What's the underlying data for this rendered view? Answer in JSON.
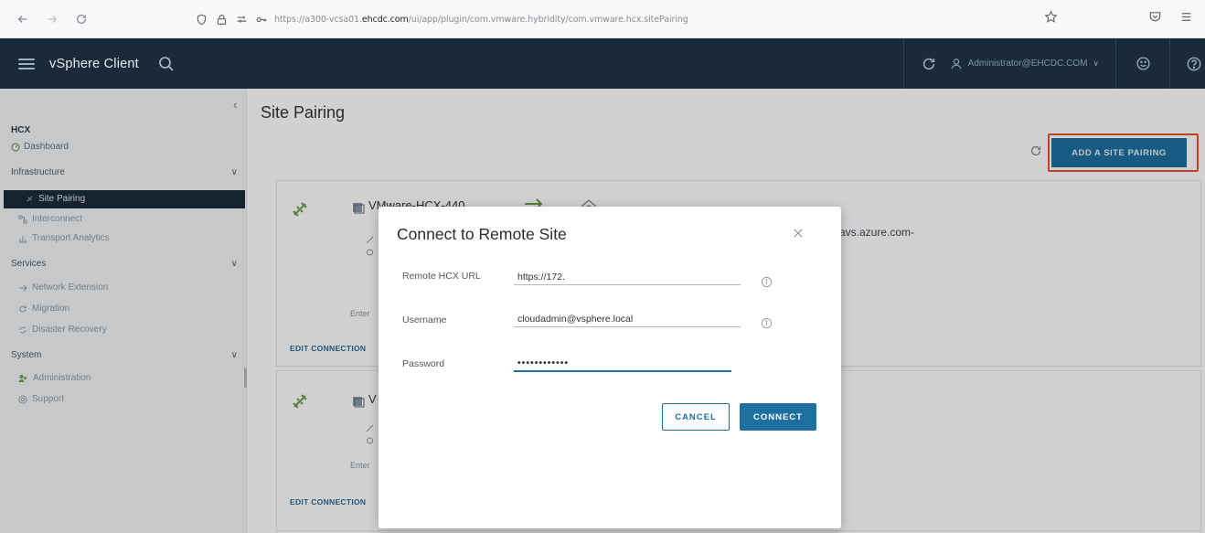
{
  "browser": {
    "url_prefix": "https://a300-vcsa01.",
    "url_domain": "ehcdc.com",
    "url_suffix": "/ui/app/plugin/com.vmware.hybridity/com.vmware.hcx.sitePairing"
  },
  "header": {
    "app_title": "vSphere Client",
    "user": "Administrator@EHCDC.COM"
  },
  "sidebar": {
    "hcx_label": "HCX",
    "dashboard": "Dashboard",
    "sections": [
      {
        "label": "Infrastructure",
        "items": [
          "Site Pairing",
          "Interconnect",
          "Transport Analytics"
        ]
      },
      {
        "label": "Services",
        "items": [
          "Network Extension",
          "Migration",
          "Disaster Recovery"
        ]
      },
      {
        "label": "System",
        "items": [
          "Administration",
          "Support"
        ]
      }
    ],
    "active_item": "Site Pairing"
  },
  "main": {
    "page_title": "Site Pairing",
    "add_button": "ADD A SITE PAIRING",
    "cards": [
      {
        "title": "VMware-HCX-440",
        "remote": "avs.azure.com-",
        "ent": "Enter",
        "edit": "EDIT CONNECTION"
      },
      {
        "title": "V",
        "ent": "Enter",
        "edit": "EDIT CONNECTION"
      }
    ]
  },
  "modal": {
    "title": "Connect to Remote Site",
    "fields": {
      "url_label": "Remote HCX URL",
      "url_value": "https://172.",
      "username_label": "Username",
      "username_value": "cloudadmin@vsphere.local",
      "password_label": "Password",
      "password_value": "••••••••••••"
    },
    "cancel_label": "CANCEL",
    "connect_label": "CONNECT"
  },
  "colors": {
    "header_bg": "#1b2a38",
    "accent": "#1d6fa0",
    "highlight_outline": "#e1532b",
    "link_green": "#6c9c4a"
  }
}
